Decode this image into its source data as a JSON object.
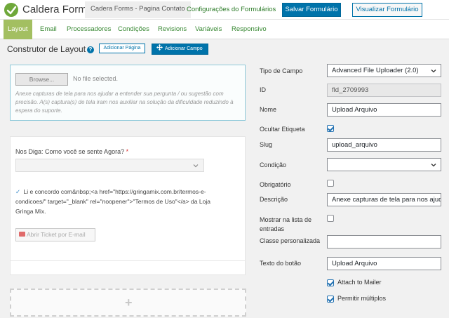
{
  "topbar": {
    "brand": "Caldera Forms",
    "form_name": "Cadera Forms - Pagina Contato",
    "config_link": "Configurações do Formulários",
    "save_label": "Salvar Formulário",
    "view_label": "Visualizar Formulário"
  },
  "tabs": [
    {
      "label": "Layout",
      "active": true
    },
    {
      "label": "Email"
    },
    {
      "label": "Processadores"
    },
    {
      "label": "Condições"
    },
    {
      "label": "Revisions"
    },
    {
      "label": "Variáveis"
    },
    {
      "label": "Responsivo"
    }
  ],
  "layout": {
    "title": "Construtor de Layout",
    "add_page": "Adicionar Página",
    "add_field": "Adicionar Campo"
  },
  "file_field": {
    "browse": "Browse...",
    "no_file": "No file selected.",
    "help": "Anexe capturas de tela para nos ajudar a entender sua pergunta / ou sugestão com precisão. A(s) captura(s) de tela iram nos auxiliar na solução da dificuldade reduzindo à espera do suporte."
  },
  "row2": {
    "question": "Nos Diga: Como você se sente Agora?",
    "required_mark": "*",
    "consent_check": "✓",
    "consent_text": "Li e concordo com&nbsp;<a href=\"https://gringamix.com.br/termos-e-condicoes/\" target=\"_blank\" rel=\"noopener\">\"Termos de Uso\"</a> da Loja Gringa Mix.",
    "ticket_button": "Abrir Ticket por E-mail"
  },
  "add_row": {
    "symbol": "+"
  },
  "settings": {
    "tipo_label": "Tipo de Campo",
    "tipo_value": "Advanced File Uploader (2.0)",
    "id_label": "ID",
    "id_value": "fld_2709993",
    "nome_label": "Nome",
    "nome_value": "Upload Arquivo",
    "ocultar_label": "Ocultar Etiqueta",
    "ocultar_checked": true,
    "slug_label": "Slug",
    "slug_value": "upload_arquivo",
    "condicao_label": "Condição",
    "condicao_value": "",
    "obrigatorio_label": "Obrigatório",
    "obrigatorio_checked": false,
    "descricao_label": "Descrição",
    "descricao_value": "Anexe capturas de tela para nos ajudar",
    "mostrar_label": "Mostrar na lista de entradas",
    "mostrar_checked": false,
    "classe_label": "Classe personalizada",
    "classe_value": "",
    "texto_botao_label": "Texto do botão",
    "texto_botao_value": "Upload Arquivo",
    "attach_label": "Attach to Mailer",
    "attach_checked": true,
    "multiplos_label": "Permitir múltiplos",
    "multiplos_checked": true
  },
  "colors": {
    "accent_green": "#a3bf61",
    "link_green": "#3a8a35",
    "primary_blue": "#0073aa"
  }
}
